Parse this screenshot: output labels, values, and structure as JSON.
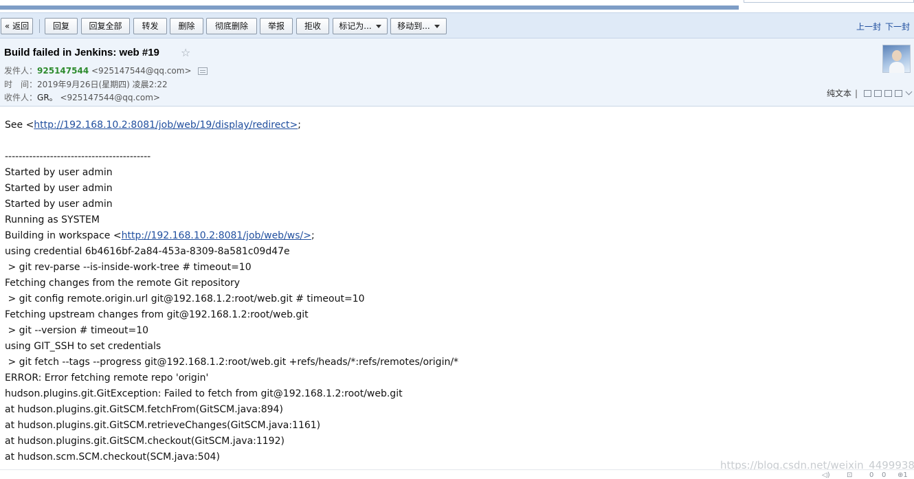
{
  "toolbar": {
    "back": "« 返回",
    "reply": "回复",
    "reply_all": "回复全部",
    "forward": "转发",
    "delete": "删除",
    "delete_forever": "彻底删除",
    "report": "举报",
    "reject": "拒收",
    "mark_as": "标记为...",
    "move_to": "移动到...",
    "prev": "上一封",
    "next": "下一封"
  },
  "header": {
    "subject": "Build failed in Jenkins: web #19",
    "star": "☆",
    "from_label": "发件人：",
    "from_name": "925147544",
    "from_addr": "<925147544@qq.com>",
    "time_label": "时　间：",
    "time_value": "2019年9月26日(星期四) 凌晨2:22",
    "to_label": "收件人：",
    "to_name": "GR。",
    "to_addr": "<925147544@qq.com>",
    "plain_text": "纯文本",
    "divider": "|"
  },
  "body": {
    "see_prefix": "See <",
    "see_link": "http://192.168.10.2:8081/job/web/19/display/redirect>",
    "see_suffix": ";",
    "separator": "------------------------------------------",
    "lines_a": [
      "Started by user admin",
      "Started by user admin",
      "Started by user admin",
      "Running as SYSTEM"
    ],
    "ws_prefix": "Building in workspace <",
    "ws_link": "http://192.168.10.2:8081/job/web/ws/>",
    "ws_suffix": ";",
    "lines_b": [
      "using credential 6b4616bf-2a84-453a-8309-8a581c09d47e",
      " > git rev-parse --is-inside-work-tree # timeout=10",
      "Fetching changes from the remote Git repository",
      " > git config remote.origin.url git@192.168.1.2:root/web.git # timeout=10",
      "Fetching upstream changes from git@192.168.1.2:root/web.git",
      " > git --version # timeout=10",
      "using GIT_SSH to set credentials",
      " > git fetch --tags --progress git@192.168.1.2:root/web.git +refs/heads/*:refs/remotes/origin/*",
      "ERROR: Error fetching remote repo 'origin'",
      "hudson.plugins.git.GitException: Failed to fetch from git@192.168.1.2:root/web.git",
      "at hudson.plugins.git.GitSCM.fetchFrom(GitSCM.java:894)",
      "at hudson.plugins.git.GitSCM.retrieveChanges(GitSCM.java:1161)",
      "at hudson.plugins.git.GitSCM.checkout(GitSCM.java:1192)",
      "at hudson.scm.SCM.checkout(SCM.java:504)"
    ]
  },
  "watermark": "https://blog.csdn.net/weixin_44999385",
  "statusbar": {
    "count_a": "0",
    "count_b": "0",
    "count_c": "1"
  },
  "icons": {
    "star": "star-outline-icon",
    "contact_card": "contact-card-icon",
    "window_tools": [
      "new-window-icon",
      "reader-icon",
      "zoom-icon",
      "print-icon",
      "chevron-down-icon"
    ]
  }
}
